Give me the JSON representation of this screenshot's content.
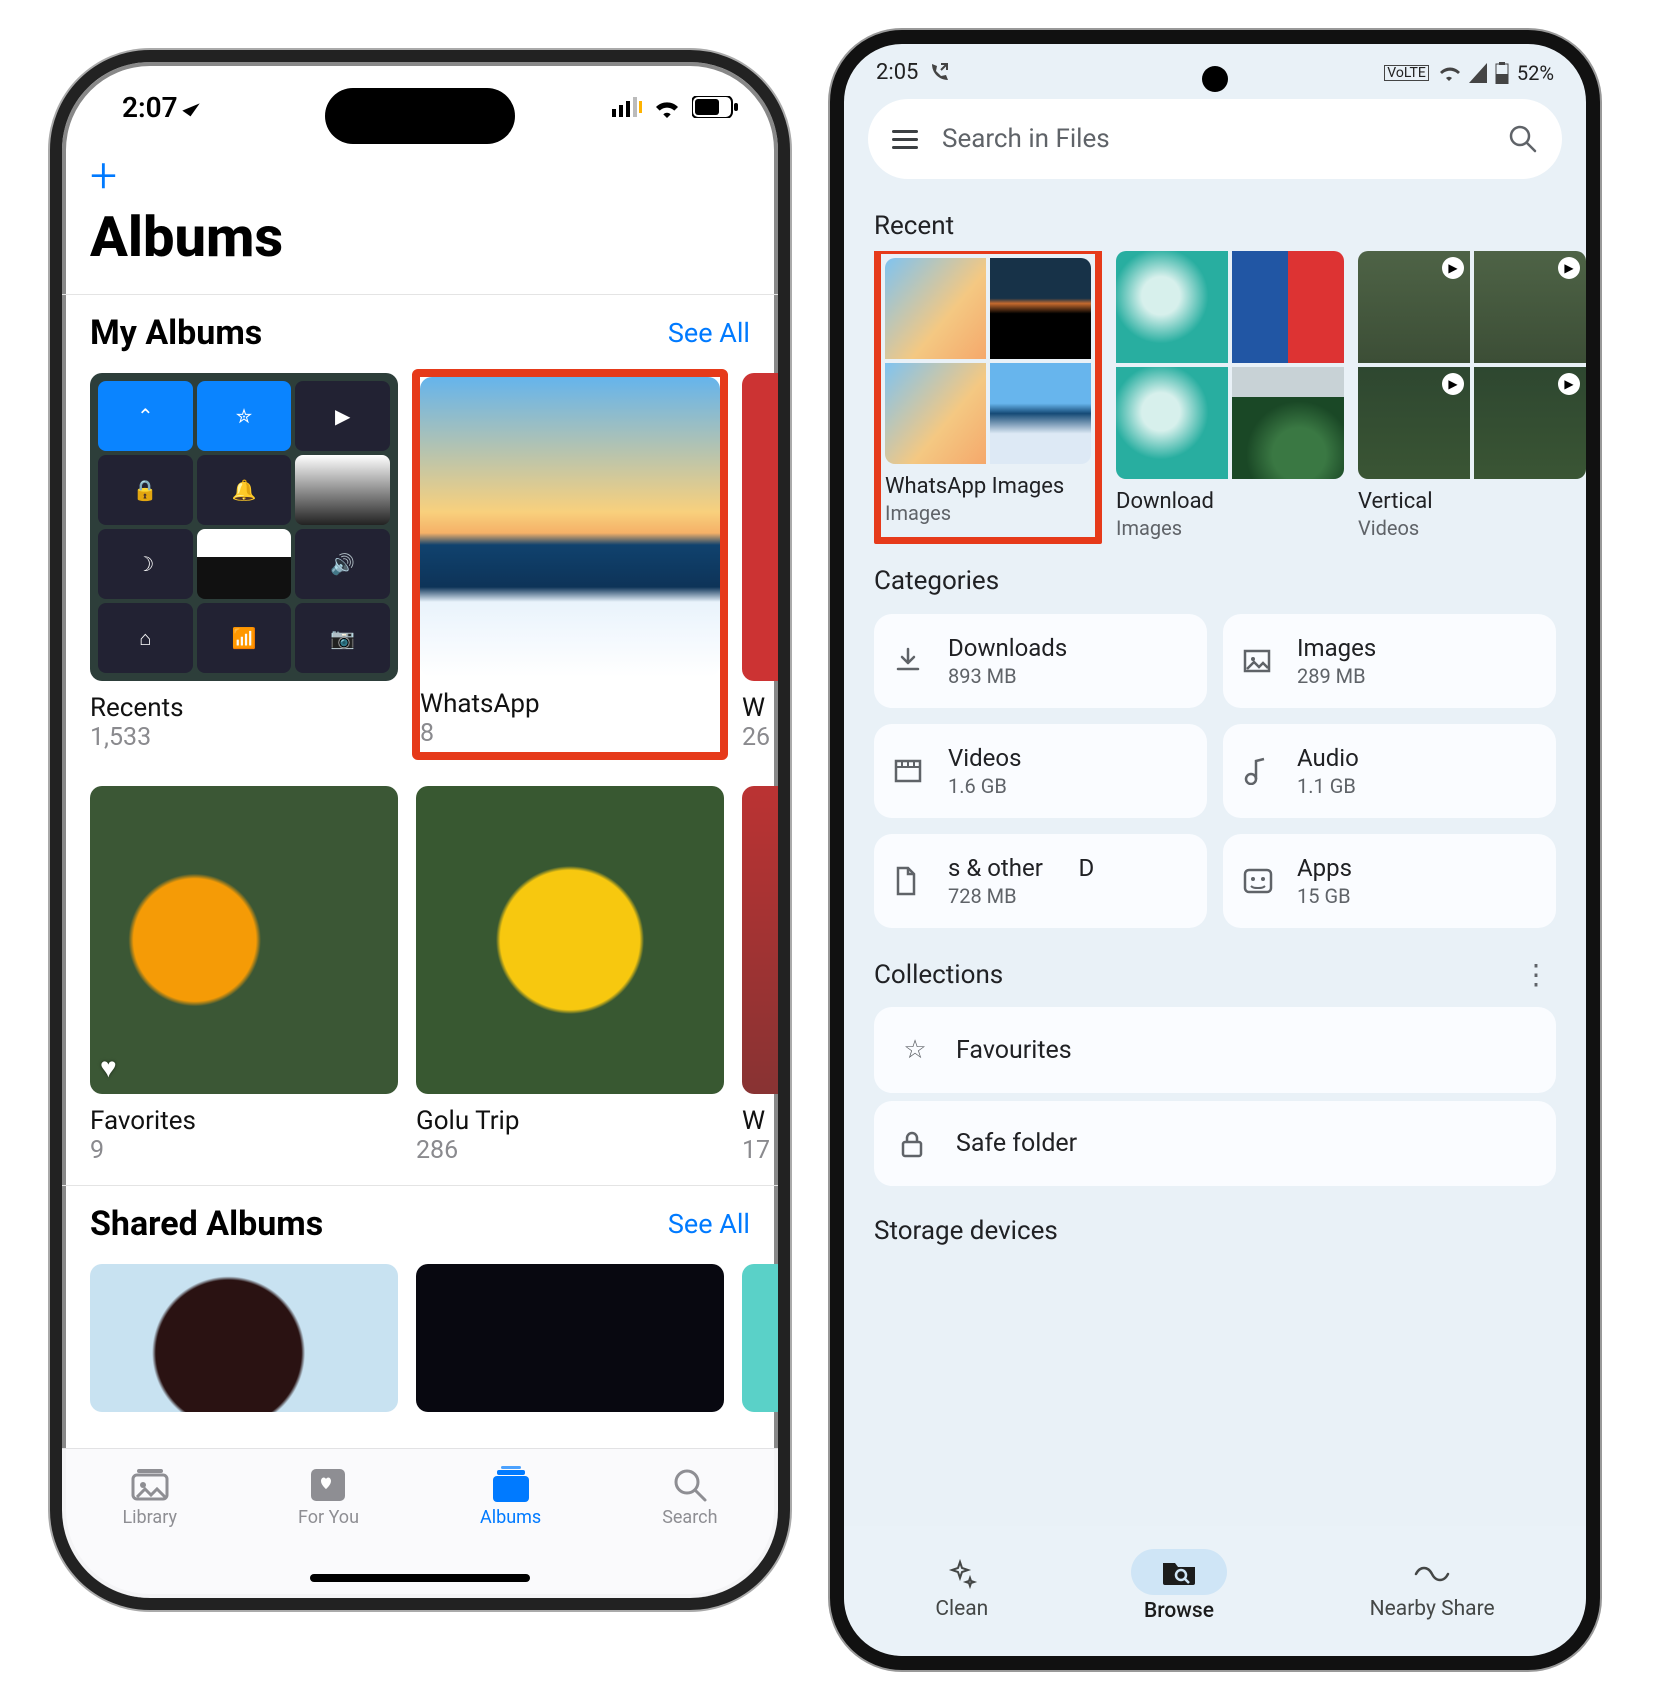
{
  "ios": {
    "status": {
      "time": "2:07",
      "battery_pct": ""
    },
    "title": "Albums",
    "sections": {
      "my_albums": {
        "title": "My Albums",
        "see_all": "See All"
      },
      "shared": {
        "title": "Shared Albums",
        "see_all": "See All"
      }
    },
    "albums": {
      "recents": {
        "name": "Recents",
        "count": "1,533"
      },
      "whatsapp": {
        "name": "WhatsApp",
        "count": "8"
      },
      "w1": {
        "name": "W",
        "count": "26"
      },
      "favorites": {
        "name": "Favorites",
        "count": "9"
      },
      "golu": {
        "name": "Golu Trip",
        "count": "286"
      },
      "w2": {
        "name": "W",
        "count": "17"
      }
    },
    "tabs": {
      "library": "Library",
      "for_you": "For You",
      "albums": "Albums",
      "search": "Search"
    }
  },
  "android": {
    "status": {
      "time": "2:05",
      "battery_label": "52%",
      "volte": "VoLTE"
    },
    "search_placeholder": "Search in Files",
    "sections": {
      "recent": "Recent",
      "categories": "Categories",
      "collections": "Collections",
      "storage": "Storage devices"
    },
    "recent": [
      {
        "name": "WhatsApp Images",
        "type": "Images"
      },
      {
        "name": "Download",
        "type": "Images"
      },
      {
        "name": "Vertical",
        "type": "Videos"
      }
    ],
    "categories": [
      {
        "label": "Downloads",
        "sub": "893 MB",
        "icon": "download-icon"
      },
      {
        "label": "Images",
        "sub": "289 MB",
        "icon": "image-icon"
      },
      {
        "label": "Videos",
        "sub": "1.6 GB",
        "icon": "video-icon"
      },
      {
        "label": "Audio",
        "sub": "1.1 GB",
        "icon": "audio-icon"
      },
      {
        "label": "s & other      D",
        "sub": "728 MB",
        "icon": "document-icon"
      },
      {
        "label": "Apps",
        "sub": "15 GB",
        "icon": "apps-icon"
      }
    ],
    "collections": {
      "favourites": "Favourites",
      "safe": "Safe folder"
    },
    "nav": {
      "clean": "Clean",
      "browse": "Browse",
      "share": "Nearby Share"
    }
  }
}
